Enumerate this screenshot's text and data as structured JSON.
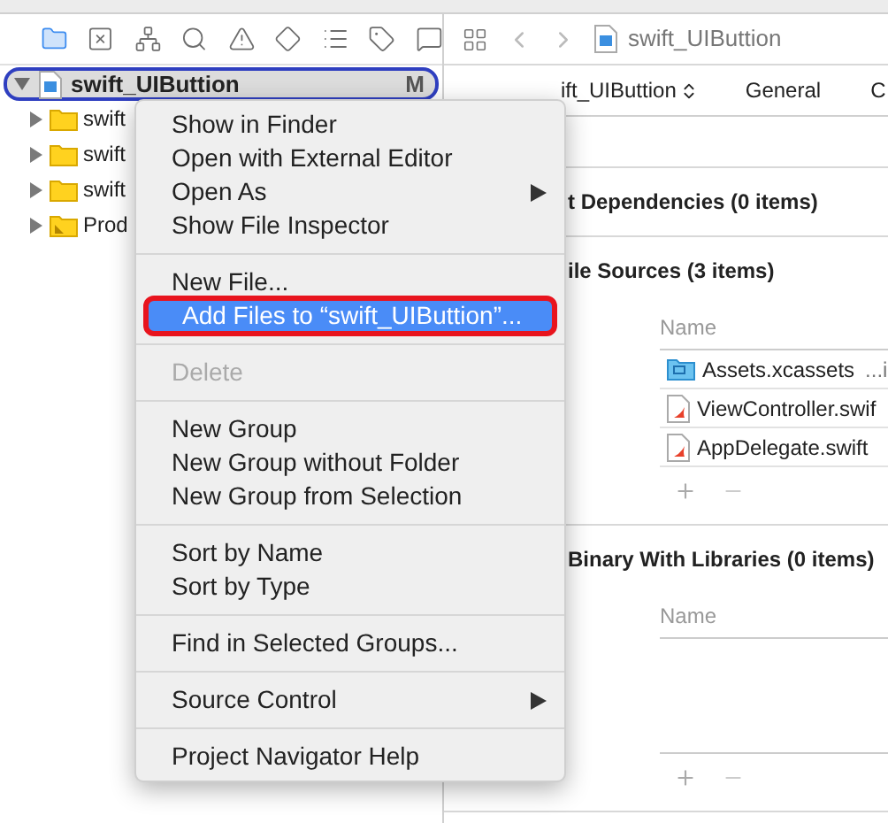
{
  "navigator_tabs": [
    {
      "kind": "folder",
      "selected": true
    },
    {
      "kind": "xbox",
      "selected": false
    },
    {
      "kind": "hierarchy",
      "selected": false
    },
    {
      "kind": "search",
      "selected": false
    },
    {
      "kind": "warning",
      "selected": false
    },
    {
      "kind": "diamond",
      "selected": false
    },
    {
      "kind": "list",
      "selected": false
    },
    {
      "kind": "tag",
      "selected": false
    },
    {
      "kind": "comment",
      "selected": false
    }
  ],
  "tree": {
    "label": "swift_UIButtion",
    "badge": "M",
    "selected": true,
    "expanded": true,
    "children": [
      {
        "label": "swift",
        "kind": "folder",
        "expanded": false
      },
      {
        "label": "swift",
        "kind": "folder",
        "expanded": false
      },
      {
        "label": "swift",
        "kind": "folder",
        "expanded": false
      },
      {
        "label": "Prod",
        "kind": "products",
        "expanded": false
      }
    ]
  },
  "context_menu": [
    {
      "kind": "item",
      "label": "Show in Finder",
      "disabled": false,
      "highlighted": false,
      "submenu": false,
      "outlined": false
    },
    {
      "kind": "item",
      "label": "Open with External Editor",
      "disabled": false,
      "highlighted": false,
      "submenu": false,
      "outlined": false
    },
    {
      "kind": "item",
      "label": "Open As",
      "disabled": false,
      "highlighted": false,
      "submenu": true,
      "outlined": false
    },
    {
      "kind": "item",
      "label": "Show File Inspector",
      "disabled": false,
      "highlighted": false,
      "submenu": false,
      "outlined": false
    },
    {
      "kind": "separator"
    },
    {
      "kind": "item",
      "label": "New File...",
      "disabled": false,
      "highlighted": false,
      "submenu": false,
      "outlined": false
    },
    {
      "kind": "item",
      "label": "Add Files to “swift_UIButtion”...",
      "disabled": false,
      "highlighted": true,
      "submenu": false,
      "outlined": true
    },
    {
      "kind": "separator"
    },
    {
      "kind": "item",
      "label": "Delete",
      "disabled": true,
      "highlighted": false,
      "submenu": false,
      "outlined": false
    },
    {
      "kind": "separator"
    },
    {
      "kind": "item",
      "label": "New Group",
      "disabled": false,
      "highlighted": false,
      "submenu": false,
      "outlined": false
    },
    {
      "kind": "item",
      "label": "New Group without Folder",
      "disabled": false,
      "highlighted": false,
      "submenu": false,
      "outlined": false
    },
    {
      "kind": "item",
      "label": "New Group from Selection",
      "disabled": false,
      "highlighted": false,
      "submenu": false,
      "outlined": false
    },
    {
      "kind": "separator"
    },
    {
      "kind": "item",
      "label": "Sort by Name",
      "disabled": false,
      "highlighted": false,
      "submenu": false,
      "outlined": false
    },
    {
      "kind": "item",
      "label": "Sort by Type",
      "disabled": false,
      "highlighted": false,
      "submenu": false,
      "outlined": false
    },
    {
      "kind": "separator"
    },
    {
      "kind": "item",
      "label": "Find in Selected Groups...",
      "disabled": false,
      "highlighted": false,
      "submenu": false,
      "outlined": false
    },
    {
      "kind": "separator"
    },
    {
      "kind": "item",
      "label": "Source Control",
      "disabled": false,
      "highlighted": false,
      "submenu": true,
      "outlined": false
    },
    {
      "kind": "separator"
    },
    {
      "kind": "item",
      "label": "Project Navigator Help",
      "disabled": false,
      "highlighted": false,
      "submenu": false,
      "outlined": false
    }
  ],
  "editor": {
    "breadcrumb": "swift_UIButtion",
    "target_selector": "ift_UIButtion",
    "tabs": [
      "General",
      "C"
    ],
    "sections": [
      {
        "kind": "collapsed",
        "title": "t Dependencies (0 items)"
      },
      {
        "kind": "table",
        "title": "ile Sources (3 items)",
        "column": "Name",
        "rows": [
          {
            "name": "Assets.xcassets",
            "extra": "...i",
            "kind": "assets"
          },
          {
            "name": "ViewController.swif",
            "kind": "swift"
          },
          {
            "name": "AppDelegate.swift",
            "kind": "swift"
          }
        ]
      },
      {
        "kind": "table",
        "title": "Binary With Libraries (0 items)",
        "column": "Name"
      }
    ]
  }
}
